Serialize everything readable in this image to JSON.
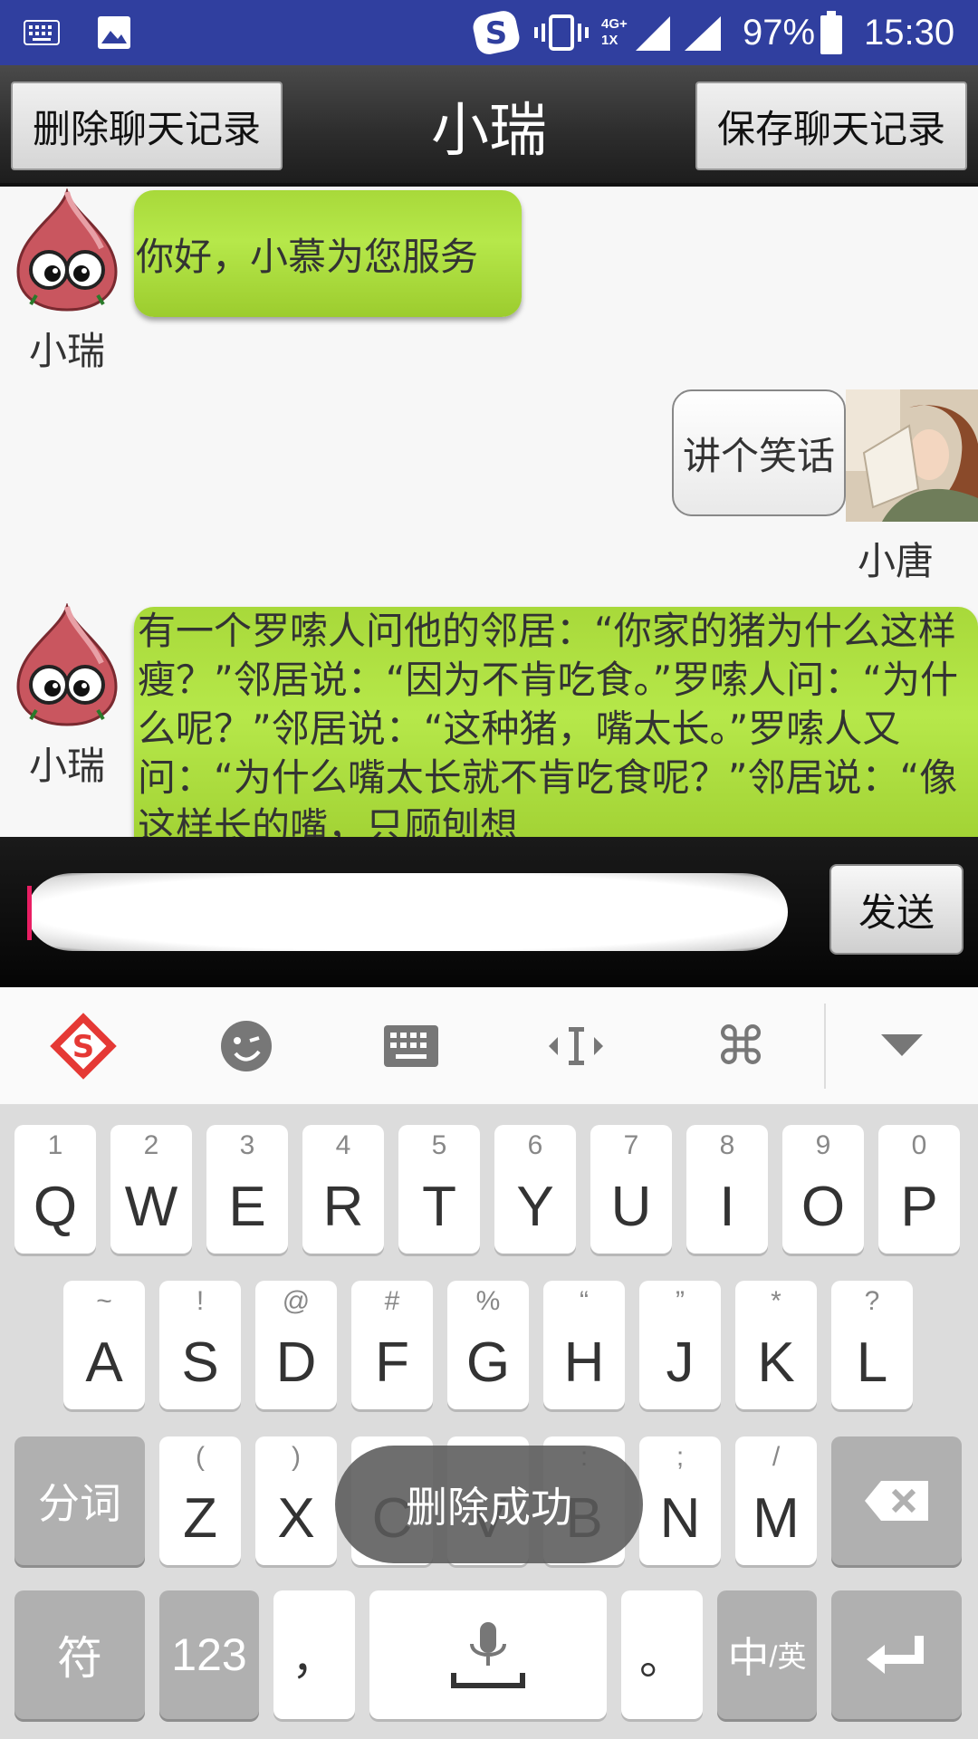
{
  "statusbar": {
    "battery": "97%",
    "time": "15:30",
    "network_top": "4G+",
    "network_bottom": "1X",
    "icons": [
      "keyboard-icon",
      "image-icon",
      "sogou-icon",
      "vibrate-icon",
      "signal-icon",
      "battery-icon"
    ]
  },
  "titlebar": {
    "left_button": "删除聊天记录",
    "title": "小瑞",
    "right_button": "保存聊天记录"
  },
  "messages": [
    {
      "sender": "小瑞",
      "side": "left",
      "text": "你好，小慕为您服务"
    },
    {
      "sender": "小唐",
      "side": "right",
      "text": "讲个笑话"
    },
    {
      "sender": "小瑞",
      "side": "left",
      "text": "有一个罗嗦人问他的邻居：“你家的猪为什么这样瘦？”邻居说：“因为不肯吃食。”罗嗦人问：“为什么呢？”邻居说：“这种猪，嘴太长。”罗嗦人又问：“为什么嘴太长就不肯吃食呢？”邻居说：“像这样长的嘴，只顾刨想"
    }
  ],
  "input": {
    "value": "",
    "placeholder": ""
  },
  "send_button": "发送",
  "keyboard": {
    "toolbar": [
      "sogou-logo-icon",
      "emoji-icon",
      "keyboard-icon",
      "cursor-move-icon",
      "command-icon",
      "collapse-icon"
    ],
    "row1": [
      {
        "hint": "1",
        "key": "Q"
      },
      {
        "hint": "2",
        "key": "W"
      },
      {
        "hint": "3",
        "key": "E"
      },
      {
        "hint": "4",
        "key": "R"
      },
      {
        "hint": "5",
        "key": "T"
      },
      {
        "hint": "6",
        "key": "Y"
      },
      {
        "hint": "7",
        "key": "U"
      },
      {
        "hint": "8",
        "key": "I"
      },
      {
        "hint": "9",
        "key": "O"
      },
      {
        "hint": "0",
        "key": "P"
      }
    ],
    "row2": [
      {
        "hint": "~",
        "key": "A"
      },
      {
        "hint": "!",
        "key": "S"
      },
      {
        "hint": "@",
        "key": "D"
      },
      {
        "hint": "#",
        "key": "F"
      },
      {
        "hint": "%",
        "key": "G"
      },
      {
        "hint": "“",
        "key": "H"
      },
      {
        "hint": "”",
        "key": "J"
      },
      {
        "hint": "*",
        "key": "K"
      },
      {
        "hint": "?",
        "key": "L"
      }
    ],
    "row3": [
      {
        "hint": "(",
        "key": "Z"
      },
      {
        "hint": ")",
        "key": "X"
      },
      {
        "hint": "",
        "key": "C"
      },
      {
        "hint": "",
        "key": "V"
      },
      {
        "hint": ":",
        "key": "B"
      },
      {
        "hint": ";",
        "key": "N"
      },
      {
        "hint": "/",
        "key": "M"
      }
    ],
    "segment_key": "分词",
    "symbol_key": "符",
    "num_key": "123",
    "comma_key": "，",
    "period_key": "。",
    "lang_key_main": "中",
    "lang_key_sub": "/英"
  },
  "toast": "删除成功"
}
